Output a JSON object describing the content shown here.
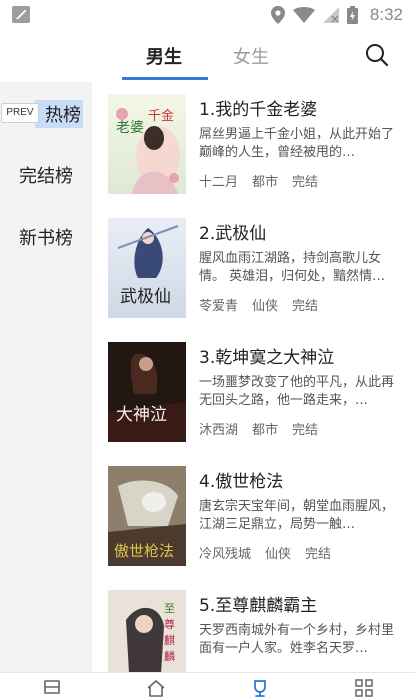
{
  "status_bar": {
    "time": "8:32",
    "icons": [
      "notification-icon",
      "location-icon",
      "wifi-icon",
      "no-signal-icon",
      "battery-charging-icon"
    ]
  },
  "header": {
    "tabs": [
      {
        "label": "男生",
        "active": true
      },
      {
        "label": "女生",
        "active": false
      }
    ],
    "search_icon": "search-icon",
    "accent_color": "#2f7bd9"
  },
  "sidebar": {
    "items": [
      {
        "label": "热榜",
        "active": true
      },
      {
        "label": "完结榜",
        "active": false
      },
      {
        "label": "新书榜",
        "active": false
      }
    ],
    "prev_label": "PREV"
  },
  "books": [
    {
      "title": "1.我的千金老婆",
      "desc": "屌丝男逼上千金小姐，从此开始了巅峰的人生，曾经被甩的…",
      "author": "十二月",
      "category": "都市",
      "status": "完结",
      "cover_text": "老婆 千金"
    },
    {
      "title": "2.武极仙",
      "desc": "腥风血雨江湖路，持剑高歌儿女情。 英雄泪，归何处，黯然情…",
      "author": "苓爱青",
      "category": "仙侠",
      "status": "完结",
      "cover_text": "武极仙"
    },
    {
      "title": "3.乾坤寞之大神泣",
      "desc": "一场噩梦改变了他的平凡，从此再无回头之路，他一路走来，…",
      "author": "沐西湖",
      "category": "都市",
      "status": "完结",
      "cover_text": "大神泣"
    },
    {
      "title": "4.傲世枪法",
      "desc": "唐玄宗天宝年间，朝堂血雨腥风，江湖三足鼎立，局势一触…",
      "author": "冷风残城",
      "category": "仙侠",
      "status": "完结",
      "cover_text": "傲世枪法"
    },
    {
      "title": "5.至尊麒麟霸主",
      "desc": "天罗西南城外有一个乡村，乡村里面有一户人家。姓李名天罗…",
      "author": "",
      "category": "",
      "status": "",
      "cover_text": "至尊麒麟霸主"
    }
  ],
  "bottom_nav": {
    "items": [
      "bookshelf-icon",
      "home-icon",
      "ranking-icon",
      "category-icon"
    ],
    "active_index": 2
  }
}
